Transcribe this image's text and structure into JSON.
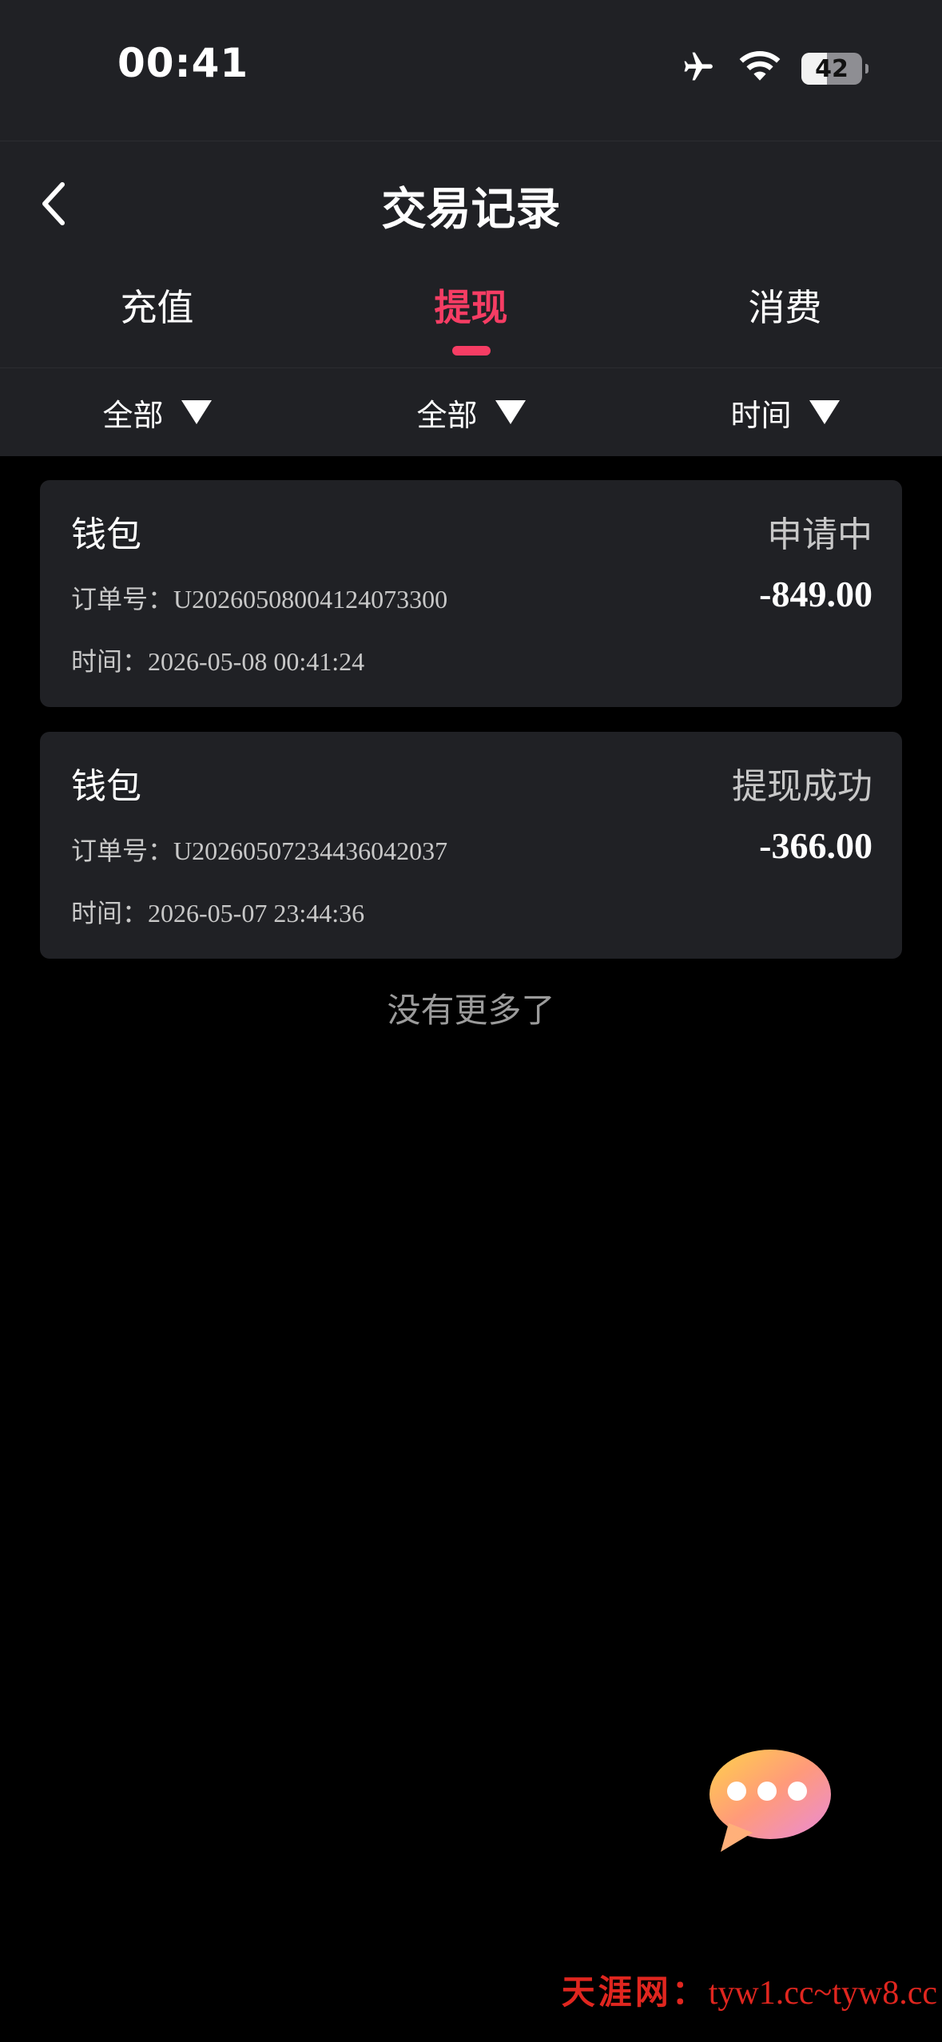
{
  "status_bar": {
    "time": "00:41",
    "battery": "42",
    "battery_level": 0.42,
    "icons": [
      "airplane-icon",
      "wifi-icon",
      "battery-icon"
    ]
  },
  "header": {
    "title": "交易记录",
    "back_icon": "chevron-left-icon"
  },
  "tabs": [
    {
      "label": "充值",
      "active": false
    },
    {
      "label": "提现",
      "active": true
    },
    {
      "label": "消费",
      "active": false
    }
  ],
  "filters": [
    {
      "label": "全部"
    },
    {
      "label": "全部"
    },
    {
      "label": "时间"
    }
  ],
  "records": [
    {
      "title": "钱包",
      "status": "申请中",
      "order": "订单号：U20260508004124073300",
      "amount": "-849.00",
      "time": "时间：2026-05-08 00:41:24"
    },
    {
      "title": "钱包",
      "status": "提现成功",
      "order": "订单号：U20260507234436042037",
      "amount": "-366.00",
      "time": "时间：2026-05-07 23:44:36"
    }
  ],
  "list_end_text": "没有更多了",
  "fab_icon": "chat-bubble-icon",
  "watermark": {
    "title": "天涯网：",
    "domains": "tyw1.cc~tyw8.cc"
  },
  "colors": {
    "accent": "#f63d64",
    "header_bg": "#202125",
    "page_bg": "#000000",
    "watermark": "#e0261f"
  }
}
